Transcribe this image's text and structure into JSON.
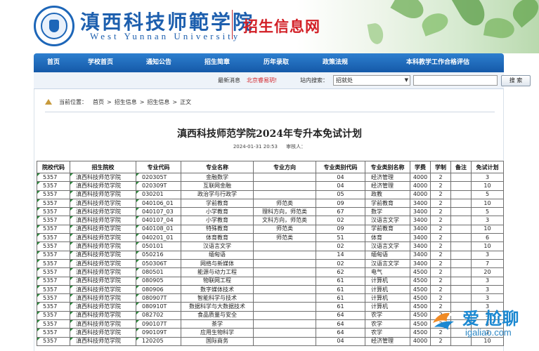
{
  "header": {
    "school_cn": "滇西科技师範学院",
    "school_en": "West Yunnan University",
    "site_title": "招生信息网"
  },
  "nav": {
    "items": [
      "首页",
      "学校首页",
      "通知公告",
      "招生简章",
      "历年录取",
      "政策法规",
      "本科教学工作合格评估"
    ]
  },
  "search_bar": {
    "news_label": "最新消息",
    "news_link": "北京睿易玥!",
    "search_label": "站内搜索：",
    "select_value": "招就处",
    "search_button": "搜 索"
  },
  "breadcrumb": {
    "label": "当前位置：",
    "items": [
      "首页",
      "招生信息",
      "招生信息",
      "正文"
    ]
  },
  "article": {
    "title": "滇西科技师范学院2024年专升本免试计划",
    "date": "2024-01-31 20:53",
    "reviewer_label": "审核人："
  },
  "table": {
    "headers": [
      "院校代码",
      "招生院校",
      "专业代码",
      "专业名称",
      "专业方向",
      "专业类别代码",
      "专业类别名称",
      "学费",
      "学制",
      "备注",
      "免试计划"
    ],
    "rows": [
      [
        "5357",
        "滇西科技师范学院",
        "020305T",
        "金融数学",
        "",
        "04",
        "经济管理",
        "4000",
        "2",
        "",
        "3"
      ],
      [
        "5357",
        "滇西科技师范学院",
        "020309T",
        "互联网金融",
        "",
        "04",
        "经济管理",
        "4000",
        "2",
        "",
        "10"
      ],
      [
        "5357",
        "滇西科技师范学院",
        "030201",
        "政治学与行政学",
        "",
        "05",
        "政教",
        "4000",
        "2",
        "",
        "5"
      ],
      [
        "5357",
        "滇西科技师范学院",
        "040106_01",
        "学前教育",
        "师范类",
        "09",
        "学前教育",
        "3400",
        "2",
        "",
        "10"
      ],
      [
        "5357",
        "滇西科技师范学院",
        "040107_03",
        "小学教育",
        "理科方向，师范类",
        "67",
        "数学",
        "3400",
        "2",
        "",
        "5"
      ],
      [
        "5357",
        "滇西科技师范学院",
        "040107_04",
        "小学教育",
        "文科方向，师范类",
        "02",
        "汉语言文学",
        "3400",
        "2",
        "",
        "3"
      ],
      [
        "5357",
        "滇西科技师范学院",
        "040108_01",
        "特殊教育",
        "师范类",
        "09",
        "学前教育",
        "3400",
        "2",
        "",
        "10"
      ],
      [
        "5357",
        "滇西科技师范学院",
        "040201_01",
        "体育教育",
        "师范类",
        "51",
        "体育",
        "3400",
        "2",
        "",
        "6"
      ],
      [
        "5357",
        "滇西科技师范学院",
        "050101",
        "汉语言文学",
        "",
        "02",
        "汉语言文学",
        "3400",
        "2",
        "",
        "10"
      ],
      [
        "5357",
        "滇西科技师范学院",
        "050216",
        "缅甸语",
        "",
        "14",
        "缅甸语",
        "3400",
        "2",
        "",
        "3"
      ],
      [
        "5357",
        "滇西科技师范学院",
        "050306T",
        "网络与新媒体",
        "",
        "02",
        "汉语言文学",
        "3400",
        "2",
        "",
        "7"
      ],
      [
        "5357",
        "滇西科技师范学院",
        "080501",
        "能源与动力工程",
        "",
        "62",
        "电气",
        "4500",
        "2",
        "",
        "20"
      ],
      [
        "5357",
        "滇西科技师范学院",
        "080905",
        "物联网工程",
        "",
        "61",
        "计算机",
        "4500",
        "2",
        "",
        "3"
      ],
      [
        "5357",
        "滇西科技师范学院",
        "080906",
        "数字媒体技术",
        "",
        "61",
        "计算机",
        "4500",
        "2",
        "",
        "3"
      ],
      [
        "5357",
        "滇西科技师范学院",
        "080907T",
        "智能科学与技术",
        "",
        "61",
        "计算机",
        "4500",
        "2",
        "",
        "3"
      ],
      [
        "5357",
        "滇西科技师范学院",
        "080910T",
        "数据科学与大数据技术",
        "",
        "61",
        "计算机",
        "4500",
        "2",
        "",
        "3"
      ],
      [
        "5357",
        "滇西科技师范学院",
        "082702",
        "食品质量与安全",
        "",
        "64",
        "农学",
        "4500",
        "2",
        "",
        "3"
      ],
      [
        "5357",
        "滇西科技师范学院",
        "090107T",
        "茶学",
        "",
        "64",
        "农学",
        "4500",
        "2",
        "",
        "3"
      ],
      [
        "5357",
        "滇西科技师范学院",
        "090109T",
        "应用生物科学",
        "",
        "64",
        "农学",
        "4500",
        "2",
        "",
        "3"
      ],
      [
        "5357",
        "滇西科技师范学院",
        "120205",
        "国际商务",
        "",
        "04",
        "经济管理",
        "4000",
        "2",
        "",
        "10"
      ]
    ]
  },
  "watermark": {
    "main": "爱 尬聊",
    "sub": "igaliao.com"
  },
  "colors": {
    "brand_blue": "#1d5fae",
    "nav_blue": "#1559a8",
    "title_red": "#d21f26"
  }
}
